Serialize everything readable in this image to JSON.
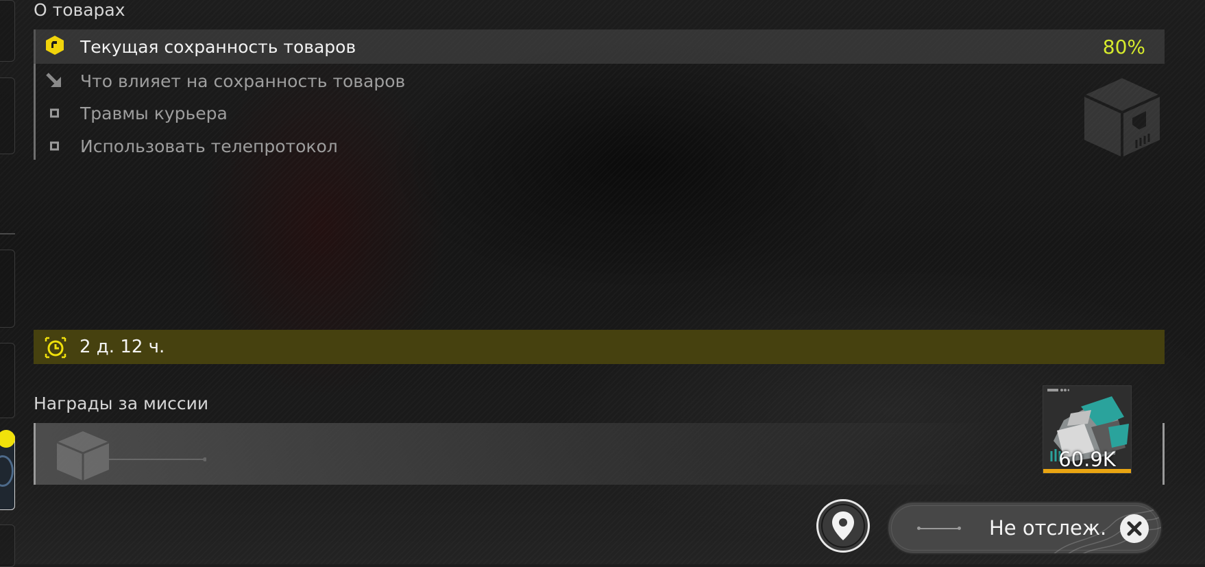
{
  "goods": {
    "title": "О товарах",
    "integrity": {
      "label": "Текущая сохранность товаров",
      "value": "80%",
      "value_color": "#d6ea2c"
    },
    "factors": {
      "heading": "Что влияет на сохранность товаров",
      "items": [
        "Травмы курьера",
        "Использовать телепротокол"
      ]
    }
  },
  "timer": {
    "value": "2 д. 12 ч.",
    "icon": "clock-icon",
    "accent": "#f1e10b"
  },
  "rewards": {
    "title": "Награды за миссии",
    "item": {
      "amount": "60.9K",
      "icon": "cargo-bundle-icon"
    }
  },
  "tracking": {
    "status": "Не отслеж.",
    "location_icon": "map-pin-icon",
    "close_icon": "close-icon"
  }
}
